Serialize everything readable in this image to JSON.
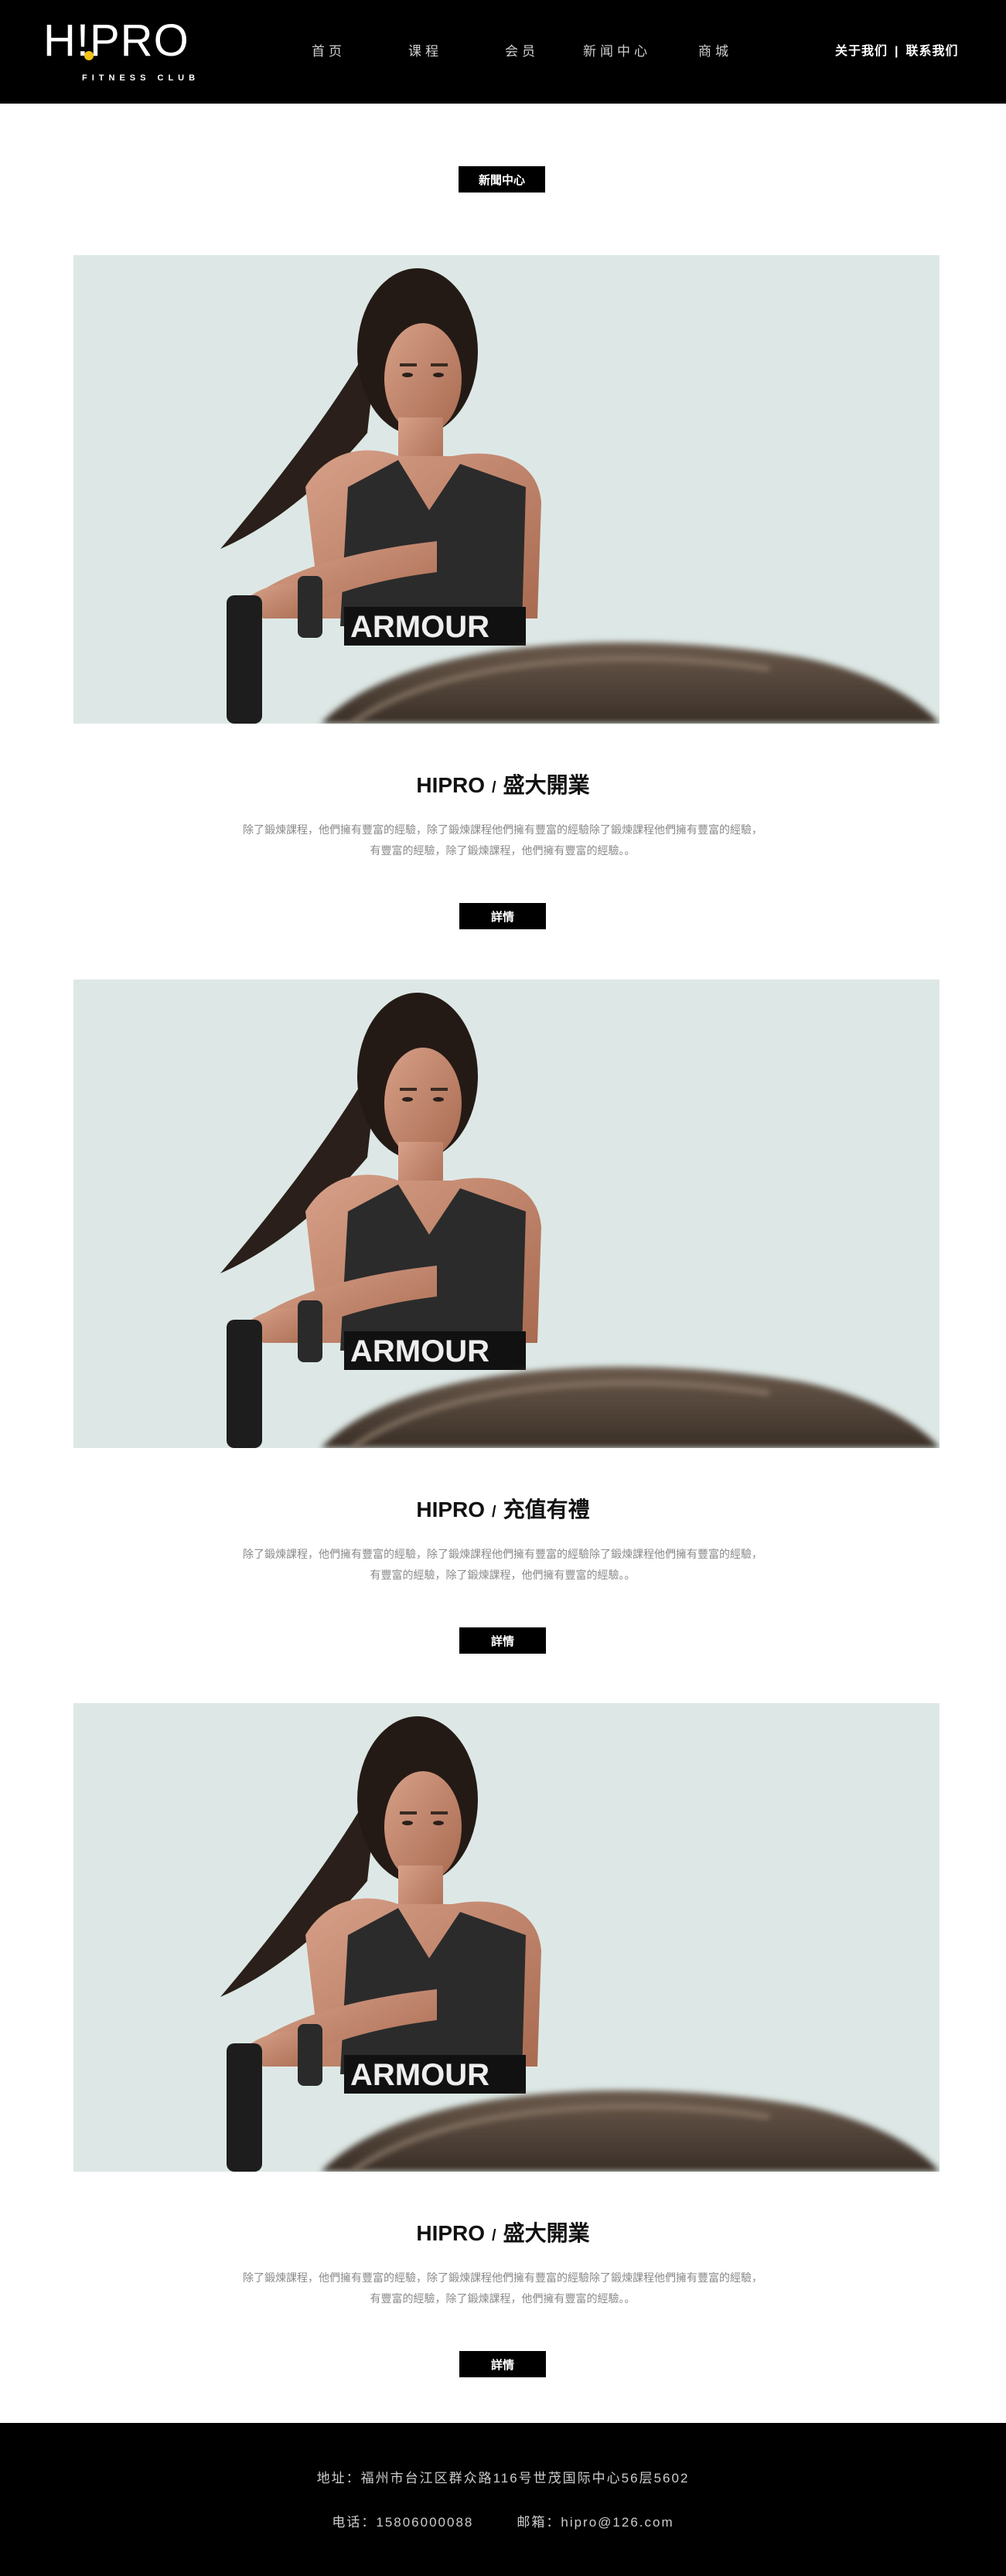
{
  "header": {
    "logo": {
      "text": "H!PRO",
      "subtitle": "FITNESS CLUB",
      "accent_color": "#f0c419"
    },
    "nav": [
      {
        "label": "首页"
      },
      {
        "label": "课程"
      },
      {
        "label": "会员"
      },
      {
        "label": "新闻中心"
      },
      {
        "label": "商城"
      }
    ],
    "top_links": [
      {
        "label": "关于我们"
      },
      {
        "label": "联系我们"
      }
    ],
    "top_links_separator": "|"
  },
  "section": {
    "tag_label": "新聞中心"
  },
  "articles": [
    {
      "title_brand": "HIPRO",
      "title_sep": "/",
      "title_text": "盛大開業",
      "desc_line1": "除了鍛煉課程，他們擁有豐富的經驗，除了鍛煉課程他們擁有豐富的經驗除了鍛煉課程他們擁有豐富的經驗，",
      "desc_line2": "有豐富的經驗，除了鍛煉課程，他們擁有豐富的經驗。。",
      "button_label": "詳情",
      "photo_icon": "athlete-battle-ropes-photo"
    },
    {
      "title_brand": "HIPRO",
      "title_sep": "/",
      "title_text": "充值有禮",
      "desc_line1": "除了鍛煉課程，他們擁有豐富的經驗，除了鍛煉課程他們擁有豐富的經驗除了鍛煉課程他們擁有豐富的經驗，",
      "desc_line2": "有豐富的經驗，除了鍛煉課程，他們擁有豐富的經驗。。",
      "button_label": "詳情",
      "photo_icon": "athlete-battle-ropes-photo"
    },
    {
      "title_brand": "HIPRO",
      "title_sep": "/",
      "title_text": "盛大開業",
      "desc_line1": "除了鍛煉課程，他們擁有豐富的經驗，除了鍛煉課程他們擁有豐富的經驗除了鍛煉課程他們擁有豐富的經驗，",
      "desc_line2": "有豐富的經驗，除了鍛煉課程，他們擁有豐富的經驗。。",
      "button_label": "詳情",
      "photo_icon": "athlete-battle-ropes-photo"
    }
  ],
  "footer": {
    "address": "地址：福州市台江区群众路116号世茂国际中心56层5602",
    "phone": "电话：15806000088",
    "email": "邮箱：hipro@126.com"
  },
  "colors": {
    "header_bg": "#000000",
    "footer_bg": "#000000",
    "button_bg": "#000000",
    "desc_text": "#8a8a8a",
    "photo_sky": "#dde8e6"
  }
}
